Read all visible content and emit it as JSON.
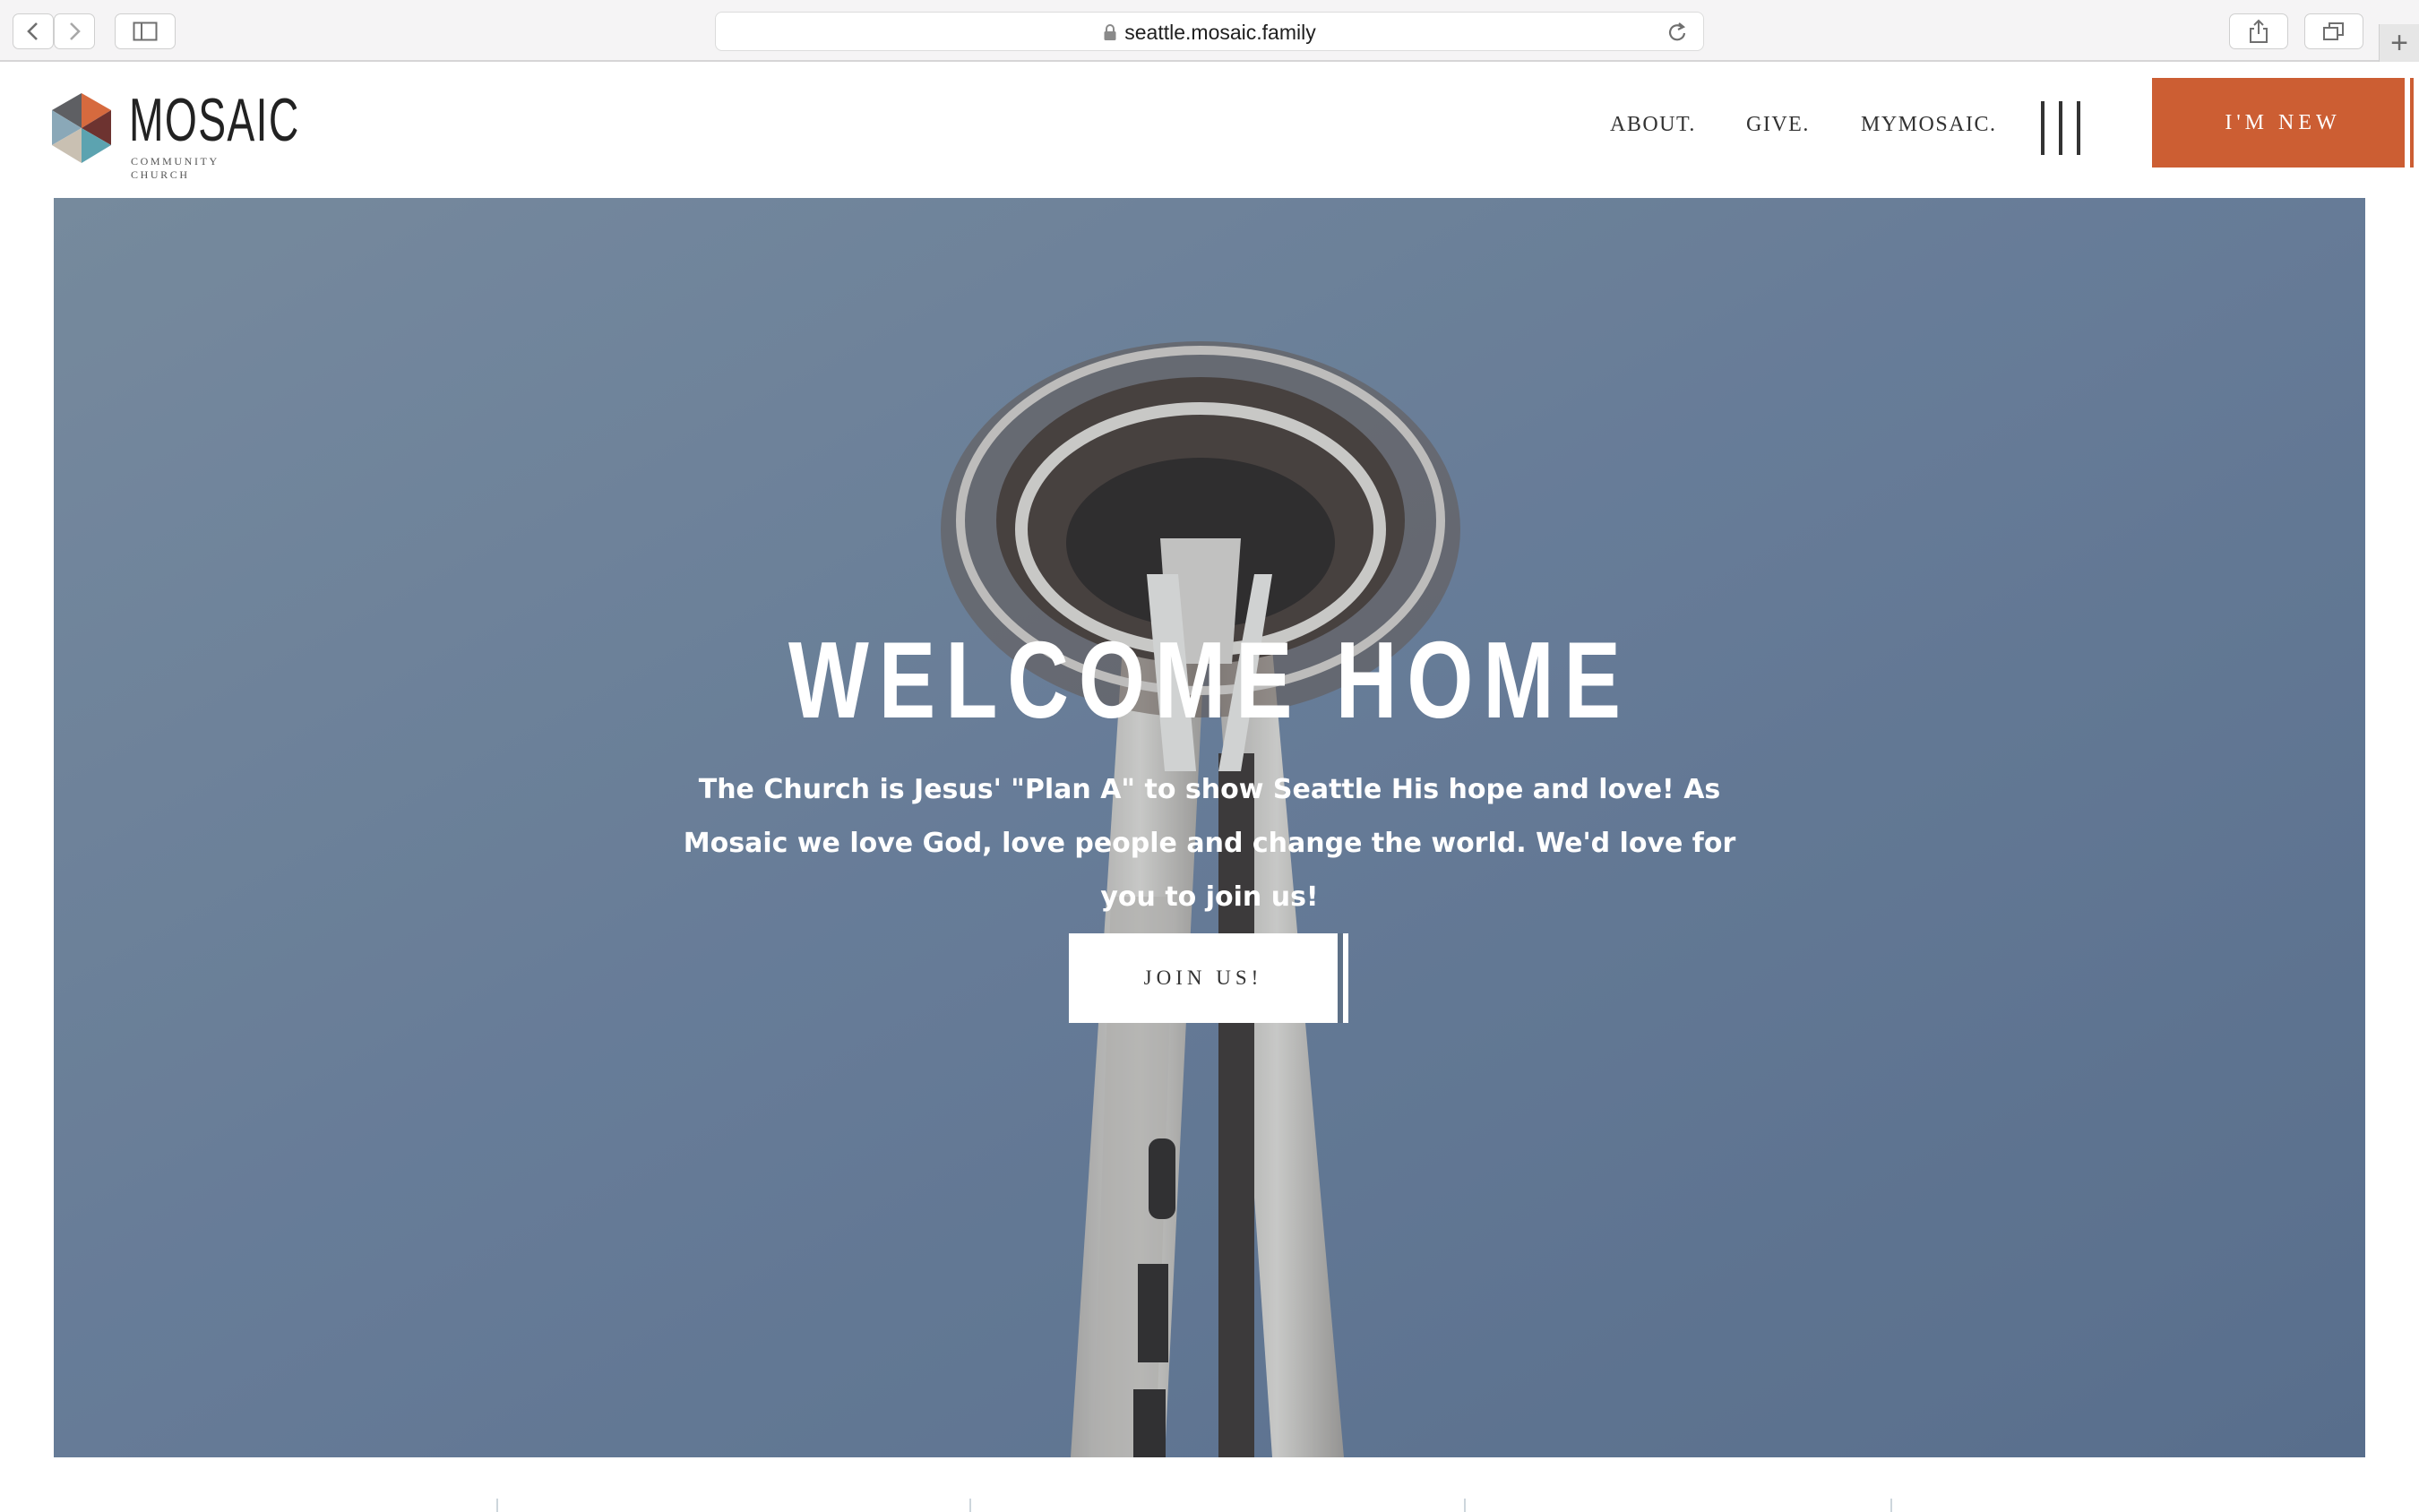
{
  "browser": {
    "url": "seattle.mosaic.family",
    "back_glyph": "‹",
    "forward_glyph": "›",
    "newtab_glyph": "+"
  },
  "site": {
    "logo": {
      "wordmark": "MOSAIC",
      "subtitle": "COMMUNITY CHURCH"
    },
    "nav": [
      {
        "label": "ABOUT."
      },
      {
        "label": "GIVE."
      },
      {
        "label": "MYMOSAIC."
      }
    ],
    "cta": {
      "label": "I'M NEW"
    }
  },
  "hero": {
    "title": "WELCOME HOME",
    "text": "The Church is Jesus' \"Plan A\" to show Seattle His hope and love! As Mosaic we love God, love people and change the world. We'd love for you to join us!",
    "button": "JOIN US!"
  },
  "colors": {
    "accent": "#cc5e33",
    "sky": "#7488a0",
    "chrome": "#f5f4f5"
  },
  "icons": [
    "back-arrow-icon",
    "forward-arrow-icon",
    "sidebar-icon",
    "lock-icon",
    "reload-icon",
    "share-icon",
    "tabs-icon",
    "plus-icon",
    "hamburger-menu-icon",
    "logo-hexagon-icon"
  ]
}
